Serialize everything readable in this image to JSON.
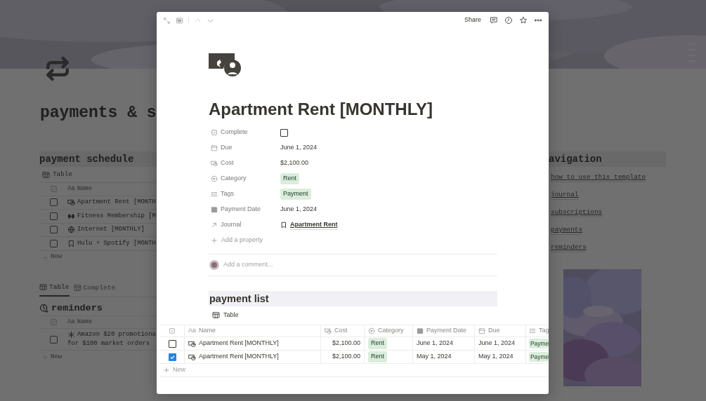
{
  "page": {
    "title": "payments & s",
    "schedule": {
      "heading": "payment schedule",
      "view_tab": "Table",
      "column": {
        "type_icon": "Aa",
        "label": "Name"
      },
      "rows": [
        {
          "kind": "money",
          "name": "Apartment Rent [MONTH",
          "checked": false
        },
        {
          "kind": "dumbbell",
          "name": "Fitness Membership [M",
          "checked": false
        },
        {
          "kind": "globe",
          "name": "Internet [MONTHLY]",
          "checked": false
        },
        {
          "kind": "bookmark",
          "name": "Hulu + Spotify [MONTH",
          "checked": false
        }
      ],
      "new": "New"
    },
    "reminders": {
      "tabs": [
        {
          "label": "Table",
          "selected": true
        },
        {
          "label": "Complete",
          "selected": false
        }
      ],
      "heading": "reminders",
      "column": {
        "type_icon": "Aa",
        "label": "Name"
      },
      "rows": [
        {
          "kind": "sparkle",
          "lines": [
            "Amazon $20 promotiona",
            "for $100 market orders"
          ],
          "checked": false
        }
      ],
      "new": "New"
    },
    "navigation": {
      "heading": "avigation",
      "links": [
        "how to use this template",
        "journal",
        "subscriptions",
        "payments",
        "reminders"
      ]
    }
  },
  "peek": {
    "toolbar": {
      "share": "Share"
    },
    "page_title": "Apartment Rent [MONTHLY]",
    "properties": [
      {
        "kind": "checkbox",
        "label": "Complete",
        "checked": false
      },
      {
        "kind": "date",
        "label": "Due",
        "value": "June 1, 2024"
      },
      {
        "kind": "number",
        "label": "Cost",
        "value": "$2,100.00"
      },
      {
        "kind": "select",
        "label": "Category",
        "value": "Rent"
      },
      {
        "kind": "multi_select",
        "label": "Tags",
        "value": "Payment"
      },
      {
        "kind": "payment_date",
        "label": "Payment Date",
        "value": "June 1, 2024"
      },
      {
        "kind": "relation",
        "label": "Journal",
        "value": "Apartment Rent"
      }
    ],
    "add_property": "Add a property",
    "comment_placeholder": "Add a comment...",
    "payment_list": {
      "heading": "payment list",
      "view_tab": "Table",
      "columns": [
        {
          "kind": "checkbox"
        },
        {
          "kind": "title",
          "type_icon": "Aa",
          "label": "Name"
        },
        {
          "kind": "number",
          "label": "Cost"
        },
        {
          "kind": "select",
          "label": "Category"
        },
        {
          "kind": "payment_date",
          "label": "Payment Date"
        },
        {
          "kind": "date",
          "label": "Due"
        },
        {
          "kind": "multi_select",
          "label": "Tag"
        }
      ],
      "rows": [
        {
          "checked": false,
          "name": "Apartment Rent [MONTHLY]",
          "cost": "$2,100.00",
          "category": "Rent",
          "payment_date": "June 1, 2024",
          "due": "June 1, 2024",
          "tags": "Payme"
        },
        {
          "checked": true,
          "name": "Apartment Rent [MONTHLY]",
          "cost": "$2,100.00",
          "category": "Rent",
          "payment_date": "May 1, 2024",
          "due": "May 1, 2024",
          "tags": "Payme"
        }
      ],
      "new": "New"
    }
  }
}
